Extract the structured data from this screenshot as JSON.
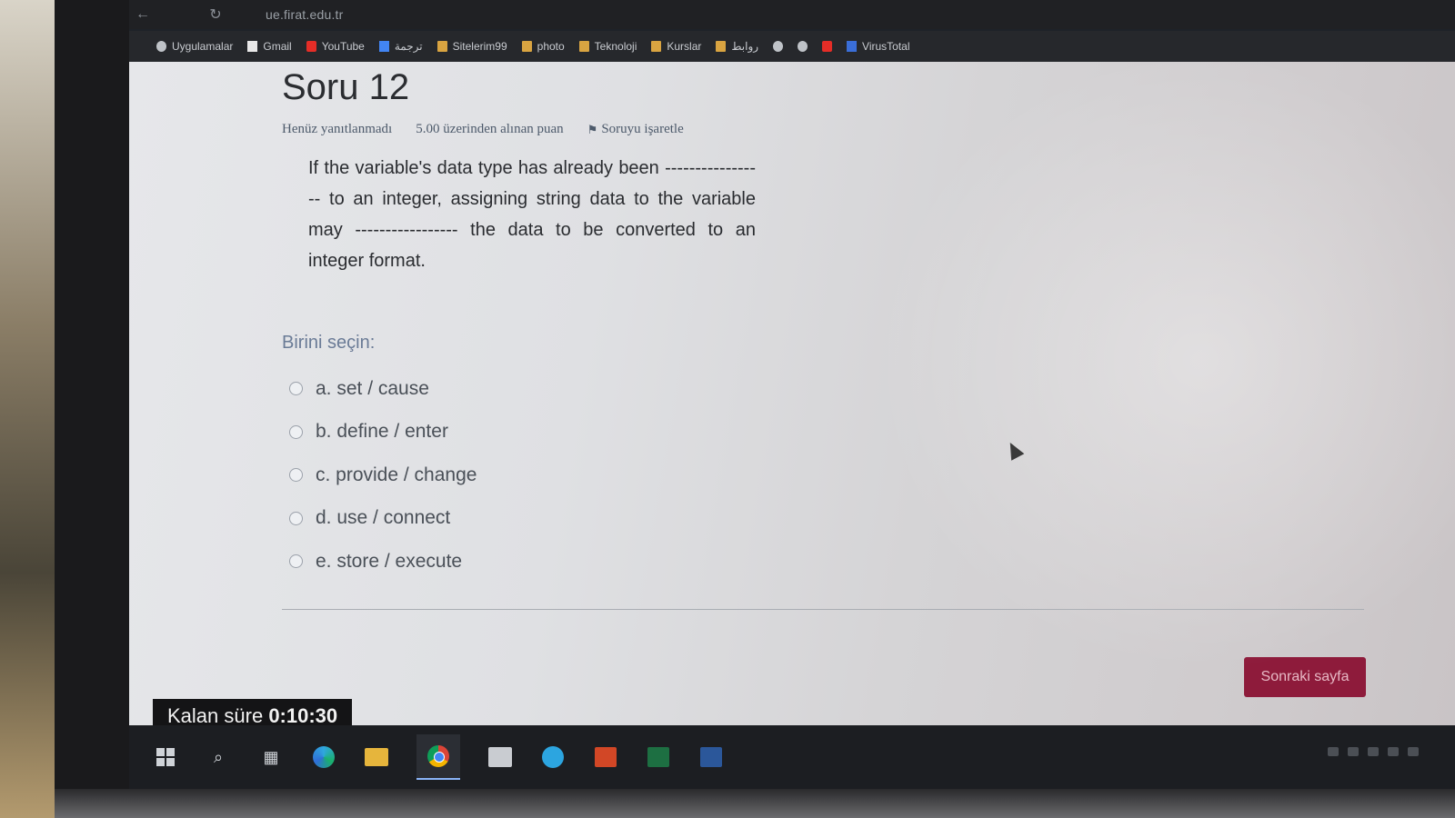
{
  "browser": {
    "url": "ue.firat.edu.tr",
    "bookmarks": [
      {
        "label": "Uygulamalar",
        "icon": "apps-icon"
      },
      {
        "label": "Gmail",
        "icon": "gmail-icon"
      },
      {
        "label": "YouTube",
        "icon": "youtube-icon"
      },
      {
        "label": "ترجمة",
        "icon": "translate-icon"
      },
      {
        "label": "Sitelerim99",
        "icon": "folder-icon"
      },
      {
        "label": "photo",
        "icon": "folder-icon"
      },
      {
        "label": "Teknoloji",
        "icon": "folder-icon"
      },
      {
        "label": "Kurslar",
        "icon": "folder-icon"
      },
      {
        "label": "روابط",
        "icon": "folder-icon"
      },
      {
        "label": "VirusTotal",
        "icon": "virustotal-icon"
      }
    ]
  },
  "question": {
    "title": "Soru 12",
    "status": "Henüz yanıtlanmadı",
    "points": "5.00 üzerinden alınan puan",
    "flag_label": "Soruyu işaretle",
    "text": "If the variable's data type has already been ----------------- to an integer, assigning string data to the variable may ----------------- the data to be converted to an integer format.",
    "choose_label": "Birini seçin:",
    "answers": [
      "a. set / cause",
      "b. define / enter",
      "c. provide / change",
      "d. use / connect",
      "e. store / execute"
    ]
  },
  "footer": {
    "next_button": "Sonraki sayfa",
    "timer_label": "Kalan süre",
    "timer_value": "0:10:30"
  }
}
